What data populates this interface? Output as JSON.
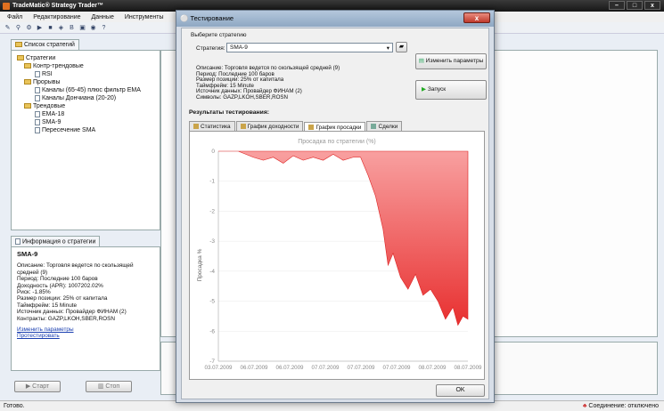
{
  "app": {
    "title": "TradeMatic® Strategy Trader™"
  },
  "menu": [
    "Файл",
    "Редактирование",
    "Данные",
    "Инструменты"
  ],
  "left": {
    "tab": "Список стратегий",
    "tree": [
      {
        "label": "Стратегии",
        "level": 0,
        "icon": "folder"
      },
      {
        "label": "Контр-трендовые",
        "level": 1,
        "icon": "folder"
      },
      {
        "label": "RSI",
        "level": 2,
        "icon": "doc"
      },
      {
        "label": "Прорывы",
        "level": 1,
        "icon": "folder"
      },
      {
        "label": "Каналы (65-45) плюс фильтр EMA",
        "level": 2,
        "icon": "doc"
      },
      {
        "label": "Каналы Дончиана (20-20)",
        "level": 2,
        "icon": "doc"
      },
      {
        "label": "Трендовые",
        "level": 1,
        "icon": "folder"
      },
      {
        "label": "EMA-18",
        "level": 2,
        "icon": "doc"
      },
      {
        "label": "SMA-9",
        "level": 2,
        "icon": "doc"
      },
      {
        "label": "Пересечение SMA",
        "level": 2,
        "icon": "doc"
      }
    ]
  },
  "info": {
    "tab": "Информация о стратегии",
    "title": "SMA-9",
    "lines": [
      "Описание: Торговля ведется по скользящей",
      "средней (9)",
      "Период: Последние 100 баров",
      "Доходность (APR): 1007202.02%",
      "Риск: -1.85%",
      "Размер позиции: 25% от капитала",
      "Таймфрейм: 15 Minute",
      "Источник данных: Провайдер ФИНАМ (2)",
      "Контракты: GAZP,LKOH,SBER,ROSN"
    ],
    "link_edit": "Изменить параметры",
    "link_test": "Протестировать"
  },
  "buttons": {
    "start": "Старт",
    "stop": "Стоп"
  },
  "status": {
    "left": "Готово.",
    "right": "Соединение: отключено"
  },
  "dialog": {
    "title": "Тестирование",
    "choose": "Выберите стратегию",
    "strategy_label": "Стратегия:",
    "strategy_value": "SMA-9",
    "edit_params": "Изменить параметры",
    "run": "Запуск",
    "desc": [
      "Описание: Торговля ведется по скользящей средней (9)",
      "Период: Последние 100 баров",
      "Размер позиции: 25% от капитала",
      "Таймфрейм: 15 Minute",
      "Источник данных: Провайдер ФИНАМ (2)",
      "Символы: GAZP,LKOH,SBER,ROSN"
    ],
    "results": "Результаты тестирования:",
    "tabs": [
      "Статистика",
      "График доходности",
      "График просадки",
      "Сделки"
    ],
    "ok": "OK"
  },
  "chart_data": {
    "type": "area",
    "title": "Просадка по стратегии (%)",
    "ylabel": "Просадка %",
    "xlabel": "",
    "ylim": [
      -7,
      0
    ],
    "y_ticks": [
      0,
      -1,
      -2,
      -3,
      -4,
      -5,
      -6,
      -7
    ],
    "x_ticks": [
      "03.07.2009",
      "06.07.2009",
      "06.07.2009",
      "07.07.2009",
      "07.07.2009",
      "07.07.2009",
      "08.07.2009",
      "08.07.2009"
    ],
    "color": "#e83030",
    "x": [
      0,
      8,
      14,
      18,
      22,
      26,
      30,
      34,
      38,
      42,
      46,
      50,
      54,
      57,
      60,
      63,
      66,
      68,
      70,
      73,
      76,
      79,
      82,
      85,
      88,
      91,
      94,
      96,
      98,
      100
    ],
    "values": [
      0,
      0,
      -0.2,
      -0.3,
      -0.2,
      -0.4,
      -0.15,
      -0.3,
      -0.2,
      -0.3,
      -0.1,
      -0.3,
      -0.2,
      -0.2,
      -0.8,
      -1.5,
      -2.6,
      -3.8,
      -3.4,
      -4.2,
      -4.6,
      -4.1,
      -4.8,
      -4.6,
      -5.0,
      -5.6,
      -5.2,
      -5.8,
      -5.5,
      -5.6
    ]
  }
}
